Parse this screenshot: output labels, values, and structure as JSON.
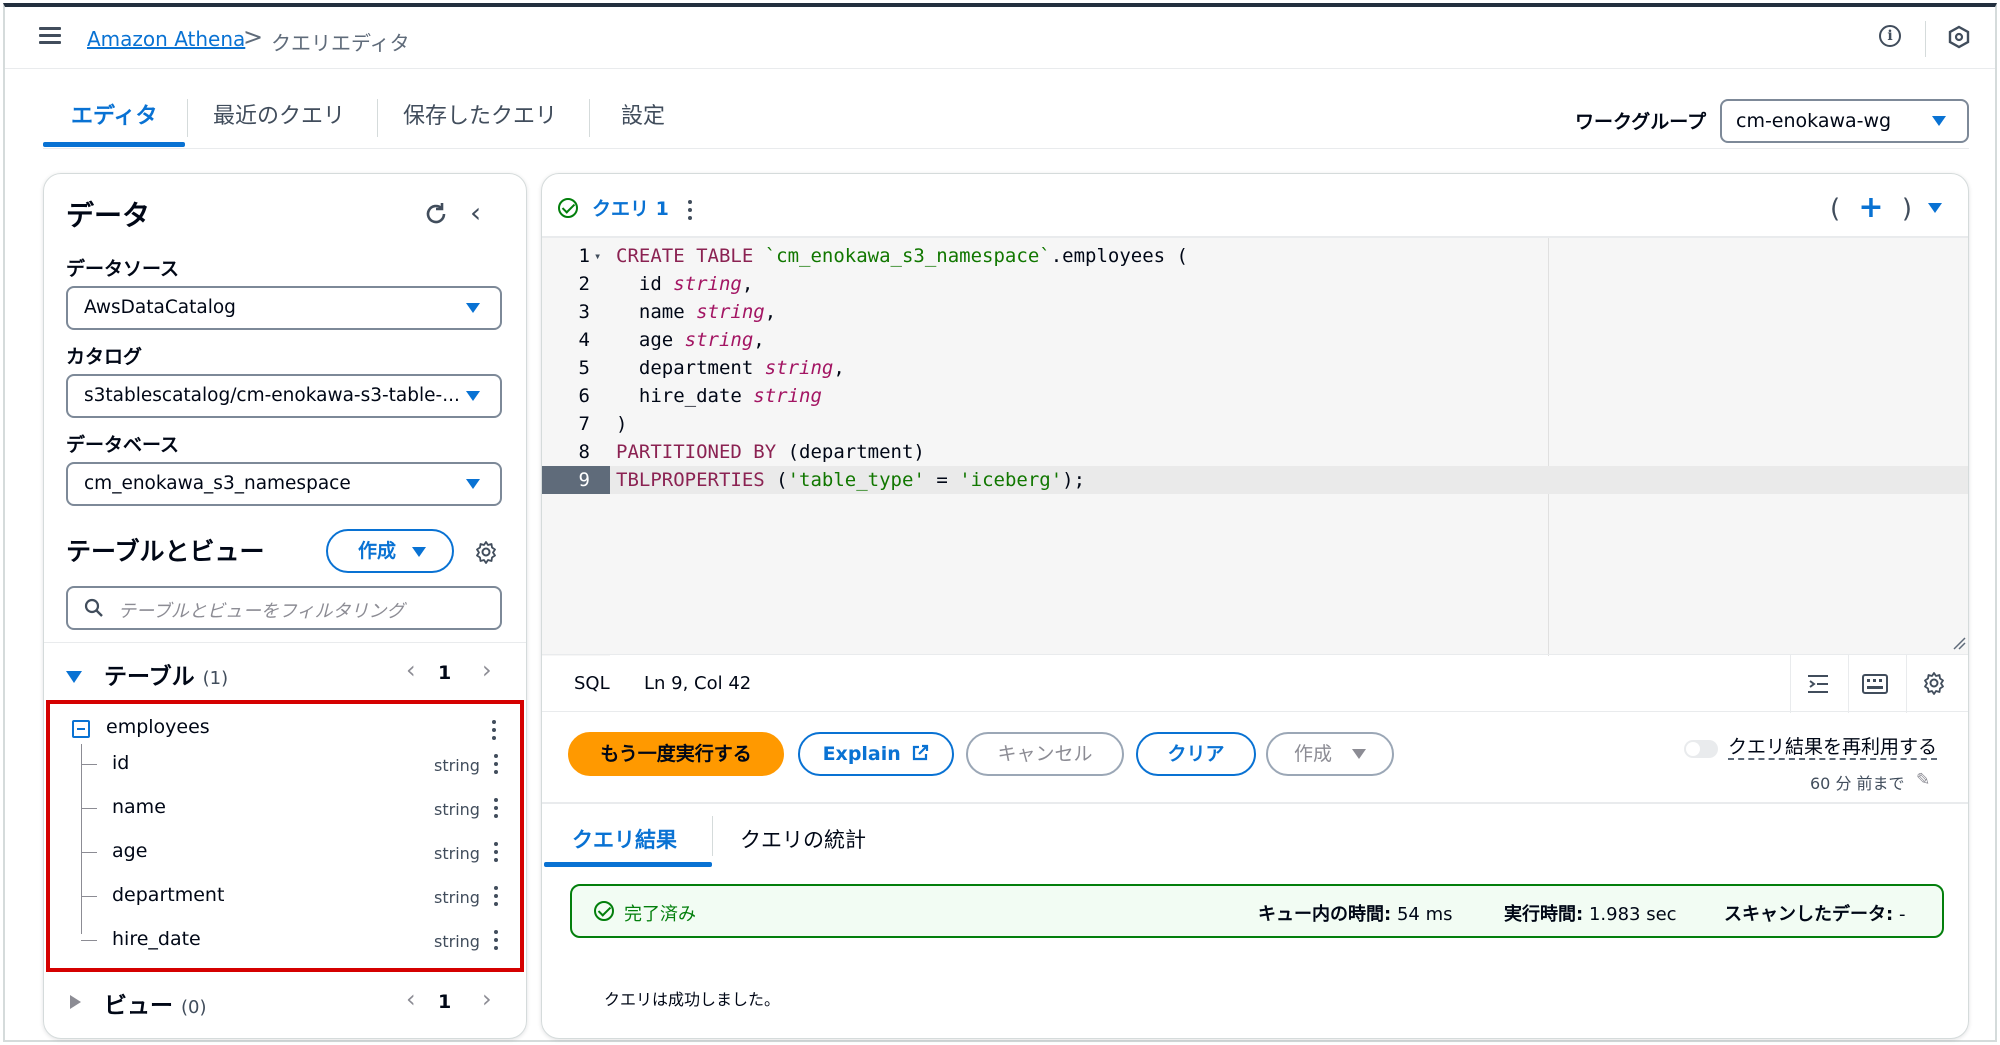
{
  "header": {
    "breadcrumb_link": "Amazon Athena",
    "breadcrumb_sep": ">",
    "breadcrumb_current": "クエリエディタ",
    "info_label": "i"
  },
  "tabs": [
    {
      "label": "エディタ"
    },
    {
      "label": "最近のクエリ"
    },
    {
      "label": "保存したクエリ"
    },
    {
      "label": "設定"
    }
  ],
  "workgroup": {
    "label": "ワークグループ",
    "value": "cm-enokawa-wg"
  },
  "data_panel": {
    "title": "データ",
    "collapse": "‹",
    "datasource_label": "データソース",
    "datasource_value": "AwsDataCatalog",
    "catalog_label": "カタログ",
    "catalog_value": "s3tablescatalog/cm-enokawa-s3-table-...",
    "database_label": "データベース",
    "database_value": "cm_enokawa_s3_namespace",
    "tables_views_title": "テーブルとビュー",
    "create_label": "作成",
    "filter_placeholder": "テーブルとビューをフィルタリング",
    "tables_section": {
      "title": "テーブル",
      "count": "(1)",
      "page": "1",
      "prev": "‹",
      "next": "›"
    },
    "views_section": {
      "title": "ビュー",
      "count": "(0)",
      "page": "1",
      "prev": "‹",
      "next": "›"
    },
    "table": {
      "name": "employees",
      "columns": [
        {
          "name": "id",
          "type": "string"
        },
        {
          "name": "name",
          "type": "string"
        },
        {
          "name": "age",
          "type": "string"
        },
        {
          "name": "department",
          "type": "string"
        },
        {
          "name": "hire_date",
          "type": "string"
        }
      ]
    }
  },
  "editor": {
    "query_tab": "クエリ 1",
    "tab_controls": {
      "left": "(",
      "plus": "+",
      "right": ")"
    },
    "lines": [
      {
        "n": "1",
        "tokens": [
          [
            "kw",
            "CREATE TABLE "
          ],
          [
            "str",
            "`cm_enokawa_s3_namespace`"
          ],
          [
            "plain",
            ".employees ("
          ]
        ]
      },
      {
        "n": "2",
        "tokens": [
          [
            "plain",
            "  id "
          ],
          [
            "ty",
            "string"
          ],
          [
            "plain",
            ","
          ]
        ]
      },
      {
        "n": "3",
        "tokens": [
          [
            "plain",
            "  name "
          ],
          [
            "ty",
            "string"
          ],
          [
            "plain",
            ","
          ]
        ]
      },
      {
        "n": "4",
        "tokens": [
          [
            "plain",
            "  age "
          ],
          [
            "ty",
            "string"
          ],
          [
            "plain",
            ","
          ]
        ]
      },
      {
        "n": "5",
        "tokens": [
          [
            "plain",
            "  department "
          ],
          [
            "ty",
            "string"
          ],
          [
            "plain",
            ","
          ]
        ]
      },
      {
        "n": "6",
        "tokens": [
          [
            "plain",
            "  hire_date "
          ],
          [
            "ty",
            "string"
          ]
        ]
      },
      {
        "n": "7",
        "tokens": [
          [
            "plain",
            ")"
          ]
        ]
      },
      {
        "n": "8",
        "tokens": [
          [
            "kw",
            "PARTITIONED BY "
          ],
          [
            "plain",
            "(department)"
          ]
        ]
      },
      {
        "n": "9",
        "tokens": [
          [
            "kw",
            "TBLPROPERTIES "
          ],
          [
            "plain",
            "("
          ],
          [
            "str",
            "'table_type'"
          ],
          [
            "plain",
            " = "
          ],
          [
            "str",
            "'iceberg'"
          ],
          [
            "plain",
            ");"
          ]
        ]
      }
    ],
    "status_lang": "SQL",
    "status_pos": "Ln 9, Col 42"
  },
  "actions": {
    "rerun": "もう一度実行する",
    "explain": "Explain",
    "cancel": "キャンセル",
    "clear": "クリア",
    "create": "作成",
    "reuse_label": "クエリ結果を再利用する",
    "reuse_sub": "60 分 前まで"
  },
  "results": {
    "tab_results": "クエリ結果",
    "tab_stats": "クエリの統計",
    "status": "完了済み",
    "queue_label": "キュー内の時間:",
    "queue_value": "54 ms",
    "exec_label": "実行時間:",
    "exec_value": "1.983 sec",
    "scan_label": "スキャンしたデータ:",
    "scan_value": "-",
    "message": "クエリは成功しました。"
  },
  "colors": {
    "accent": "#0972d3",
    "primary_button": "#ff9900",
    "success": "#037f0c",
    "highlight": "#d50000"
  }
}
